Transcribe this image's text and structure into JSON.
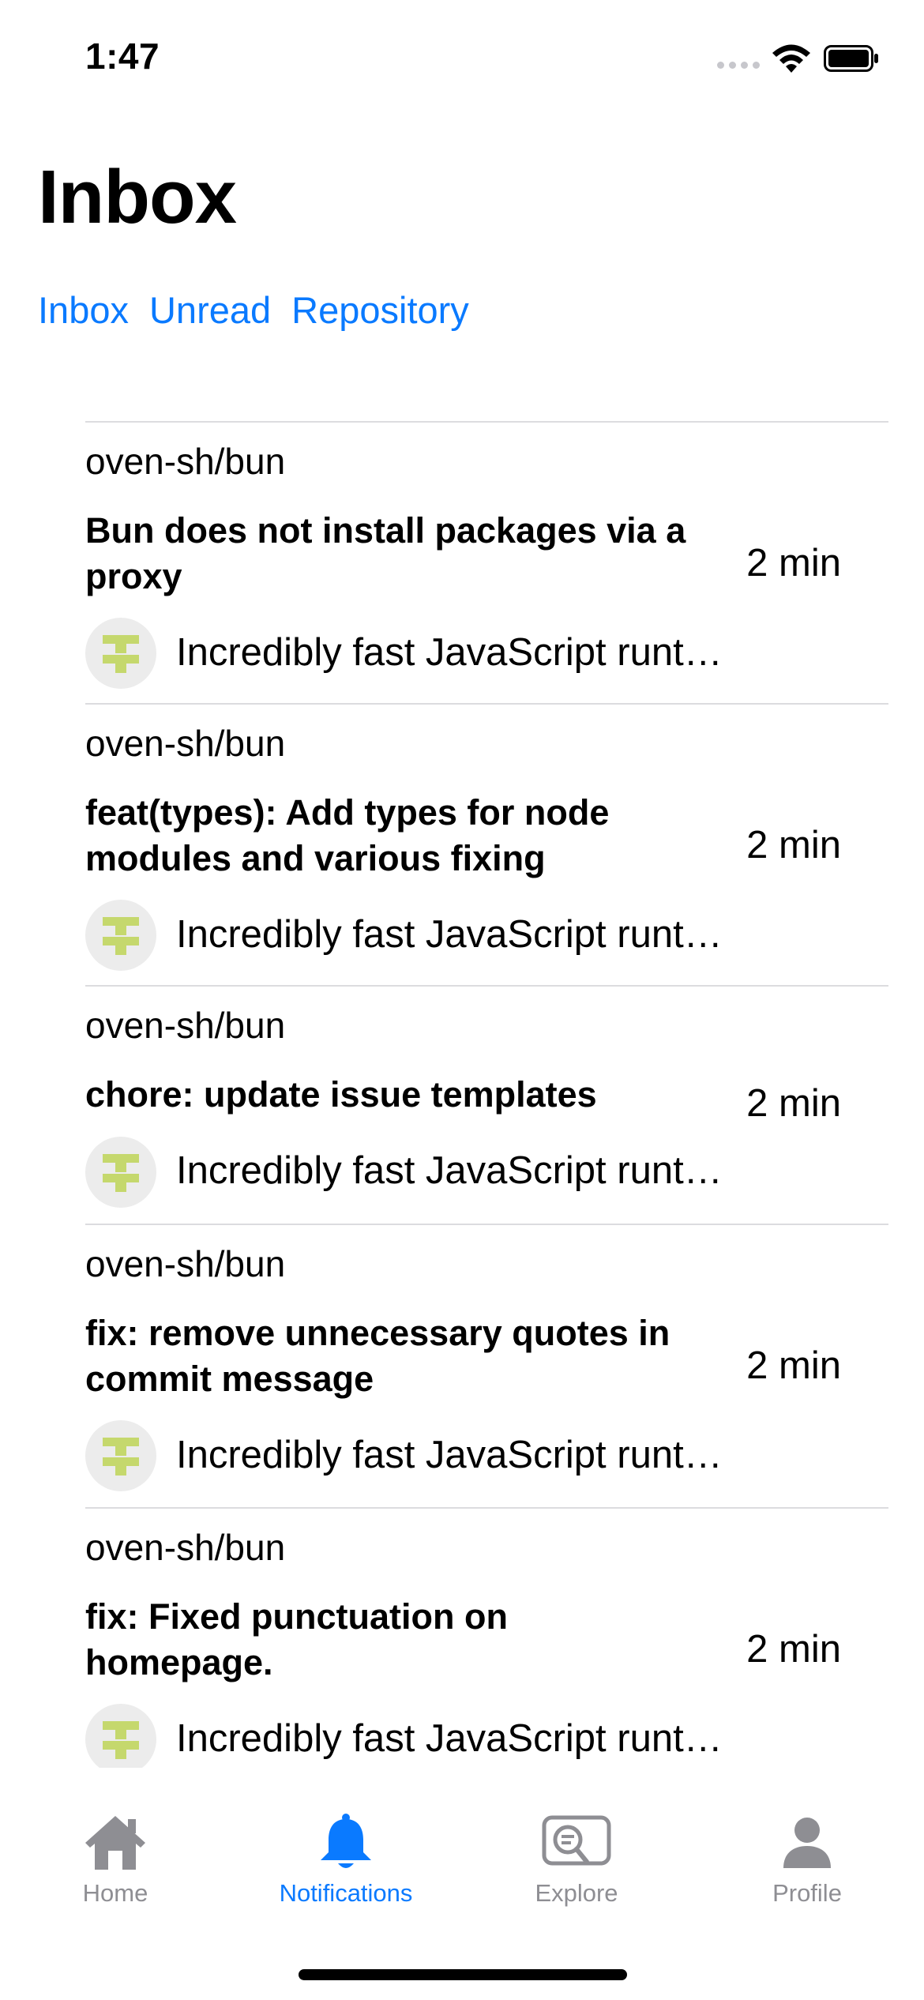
{
  "status_bar": {
    "time": "1:47"
  },
  "page": {
    "title": "Inbox"
  },
  "filters": [
    {
      "label": "Inbox"
    },
    {
      "label": "Unread"
    },
    {
      "label": "Repository"
    }
  ],
  "notifications": [
    {
      "repo": "oven-sh/bun",
      "title": "Bun does not install packages via a proxy",
      "time": "2 min",
      "description": "Incredibly fast JavaScript runtime, bundler, test runner, and package manager – all in one"
    },
    {
      "repo": "oven-sh/bun",
      "title": "feat(types): Add types for node modules and various fixing",
      "time": "2 min",
      "description": "Incredibly fast JavaScript runtime, bundler, test runner, and package manager – all in one"
    },
    {
      "repo": "oven-sh/bun",
      "title": "chore: update issue templates",
      "time": "2 min",
      "description": "Incredibly fast JavaScript runtime, bundler, test runner, and package manager – all in one"
    },
    {
      "repo": "oven-sh/bun",
      "title": "fix: remove unnecessary quotes in commit message",
      "time": "2 min",
      "description": "Incredibly fast JavaScript runtime, bundler, test runner, and package manager – all in one"
    },
    {
      "repo": "oven-sh/bun",
      "title": "fix: Fixed punctuation on homepage.",
      "time": "2 min",
      "description": "Incredibly fast JavaScript runtime, bundler, test runner, and package manager – all in one"
    }
  ],
  "tab_bar": {
    "active": "notifications",
    "tabs": [
      {
        "key": "home",
        "label": "Home",
        "icon": "house-icon"
      },
      {
        "key": "notifications",
        "label": "Notifications",
        "icon": "bell-icon"
      },
      {
        "key": "explore",
        "label": "Explore",
        "icon": "explore-search-icon"
      },
      {
        "key": "profile",
        "label": "Profile",
        "icon": "person-icon"
      }
    ]
  },
  "colors": {
    "accent": "#0a7aff",
    "inactive": "#8e8e93",
    "separator": "#dcdcdf",
    "avatar_green": "#c5d86d"
  }
}
